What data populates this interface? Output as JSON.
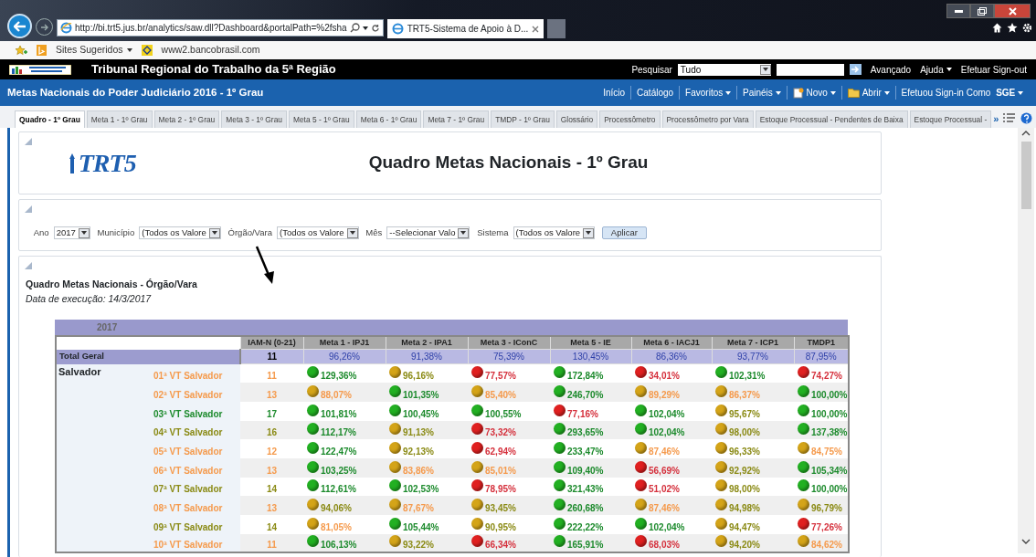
{
  "browser": {
    "address": "http://bi.trt5.jus.br/analytics/saw.dll?Dashboard&portalPath=%2fsha",
    "tab_title": "TRT5-Sistema de Apoio à D...",
    "favorites": [
      {
        "label": "Sites Sugeridos",
        "menu": true
      },
      {
        "label": "www2.bancobrasil.com",
        "menu": false
      }
    ]
  },
  "app_header": {
    "title": "Tribunal Regional do Trabalho da 5ª Região",
    "search_label": "Pesquisar",
    "search_scope": "Tudo",
    "links": [
      {
        "label": "Avançado",
        "menu": false
      },
      {
        "label": "Ajuda",
        "menu": true
      },
      {
        "label": "Efetuar Sign-out",
        "menu": false
      }
    ]
  },
  "nav": {
    "title": "Metas Nacionais do Poder Judiciário 2016 - 1º Grau",
    "links": [
      {
        "label": "Início",
        "menu": false
      },
      {
        "label": "Catálogo",
        "menu": false
      },
      {
        "label": "Favoritos",
        "menu": true
      },
      {
        "label": "Painéis",
        "menu": true
      },
      {
        "label": "Novo",
        "menu": true
      },
      {
        "label": "Abrir",
        "menu": true
      }
    ],
    "signed_in_label": "Efetuou Sign-in Como",
    "user": "SGE"
  },
  "tabs": [
    {
      "label": "Quadro - 1º Grau",
      "selected": true
    },
    {
      "label": "Meta 1 - 1º Grau",
      "selected": false
    },
    {
      "label": "Meta 2 - 1º Grau",
      "selected": false
    },
    {
      "label": "Meta 3 - 1º Grau",
      "selected": false
    },
    {
      "label": "Meta 5 - 1º Grau",
      "selected": false
    },
    {
      "label": "Meta 6 - 1º Grau",
      "selected": false
    },
    {
      "label": "Meta 7 - 1º Grau",
      "selected": false
    },
    {
      "label": "TMDP - 1º Grau",
      "selected": false
    },
    {
      "label": "Glossário",
      "selected": false
    },
    {
      "label": "Processômetro",
      "selected": false
    },
    {
      "label": "Processômetro por Vara",
      "selected": false
    },
    {
      "label": "Estoque Processual - Pendentes de Baixa",
      "selected": false
    },
    {
      "label": "Estoque Processual -",
      "selected": false
    }
  ],
  "tabs_overflow": "»",
  "title_panel": {
    "logo_text": "TRT5",
    "title": "Quadro Metas Nacionais - 1º Grau"
  },
  "filters": [
    {
      "label": "Ano",
      "value": "2017"
    },
    {
      "label": "Município",
      "value": "(Todos os Valore"
    },
    {
      "label": "Órgão/Vara",
      "value": "(Todos os Valore"
    },
    {
      "label": "Mês",
      "value": "--Selecionar Valo"
    },
    {
      "label": "Sistema",
      "value": "(Todos os Valore"
    }
  ],
  "apply_button": "Aplicar",
  "report": {
    "title": "Quadro Metas Nacionais - Órgão/Vara",
    "subtitle": "Data de execução: 14/3/2017"
  },
  "table": {
    "year": "2017",
    "columns": [
      "IAM-N (0-21)",
      "Meta 1 - IPJ1",
      "Meta 2 - IPA1",
      "Meta 3 - IConC",
      "Meta 5 - IE",
      "Meta 6 - IACJ1",
      "Meta 7 - ICP1",
      "TMDP1"
    ],
    "total": {
      "label": "Total Geral",
      "values": [
        "11",
        "96,26%",
        "91,38%",
        "75,39%",
        "130,45%",
        "86,36%",
        "93,77%",
        "87,95%"
      ]
    },
    "group": "Salvador",
    "rows": [
      {
        "name": "01ª VT Salvador",
        "kind": "low",
        "cells": [
          {
            "value": "11",
            "kind": "low"
          },
          {
            "value": "129,36%",
            "color": "#22b022",
            "kind": "good"
          },
          {
            "value": "96,16%",
            "color": "#d4a418",
            "kind": "warning"
          },
          {
            "value": "77,57%",
            "color": "#e02020",
            "kind": "bad"
          },
          {
            "value": "172,84%",
            "color": "#22b022",
            "kind": "good"
          },
          {
            "value": "34,01%",
            "color": "#e02020",
            "kind": "bad"
          },
          {
            "value": "102,31%",
            "color": "#22b022",
            "kind": "good"
          },
          {
            "value": "74,27%",
            "color": "#e02020",
            "kind": "bad"
          }
        ]
      },
      {
        "name": "02ª VT Salvador",
        "kind": "low",
        "cells": [
          {
            "value": "13",
            "kind": "low"
          },
          {
            "value": "88,07%",
            "color": "#d4a418",
            "kind": "low"
          },
          {
            "value": "101,35%",
            "color": "#22b022",
            "kind": "good"
          },
          {
            "value": "85,40%",
            "color": "#d4a418",
            "kind": "low"
          },
          {
            "value": "246,70%",
            "color": "#22b022",
            "kind": "good"
          },
          {
            "value": "89,29%",
            "color": "#d4a418",
            "kind": "low"
          },
          {
            "value": "86,37%",
            "color": "#d4a418",
            "kind": "low"
          },
          {
            "value": "100,00%",
            "color": "#22b022",
            "kind": "good"
          }
        ]
      },
      {
        "name": "03ª VT Salvador",
        "kind": "good",
        "cells": [
          {
            "value": "17",
            "kind": "good"
          },
          {
            "value": "101,81%",
            "color": "#22b022",
            "kind": "good"
          },
          {
            "value": "100,45%",
            "color": "#22b022",
            "kind": "good"
          },
          {
            "value": "100,55%",
            "color": "#22b022",
            "kind": "good"
          },
          {
            "value": "77,16%",
            "color": "#e02020",
            "kind": "bad"
          },
          {
            "value": "102,04%",
            "color": "#22b022",
            "kind": "good"
          },
          {
            "value": "95,67%",
            "color": "#d4a418",
            "kind": "warning"
          },
          {
            "value": "100,00%",
            "color": "#22b022",
            "kind": "good"
          }
        ]
      },
      {
        "name": "04ª VT Salvador",
        "kind": "warning",
        "cells": [
          {
            "value": "16",
            "kind": "warning"
          },
          {
            "value": "112,17%",
            "color": "#22b022",
            "kind": "good"
          },
          {
            "value": "91,13%",
            "color": "#d4a418",
            "kind": "warning"
          },
          {
            "value": "73,32%",
            "color": "#e02020",
            "kind": "bad"
          },
          {
            "value": "293,65%",
            "color": "#22b022",
            "kind": "good"
          },
          {
            "value": "102,04%",
            "color": "#22b022",
            "kind": "good"
          },
          {
            "value": "98,00%",
            "color": "#d4a418",
            "kind": "warning"
          },
          {
            "value": "137,38%",
            "color": "#22b022",
            "kind": "good"
          }
        ]
      },
      {
        "name": "05ª VT Salvador",
        "kind": "low",
        "cells": [
          {
            "value": "12",
            "kind": "low"
          },
          {
            "value": "122,47%",
            "color": "#22b022",
            "kind": "good"
          },
          {
            "value": "92,13%",
            "color": "#d4a418",
            "kind": "warning"
          },
          {
            "value": "62,94%",
            "color": "#e02020",
            "kind": "bad"
          },
          {
            "value": "233,47%",
            "color": "#22b022",
            "kind": "good"
          },
          {
            "value": "87,46%",
            "color": "#d4a418",
            "kind": "low"
          },
          {
            "value": "96,33%",
            "color": "#d4a418",
            "kind": "warning"
          },
          {
            "value": "84,75%",
            "color": "#d4a418",
            "kind": "low"
          }
        ]
      },
      {
        "name": "06ª VT Salvador",
        "kind": "low",
        "cells": [
          {
            "value": "13",
            "kind": "low"
          },
          {
            "value": "103,25%",
            "color": "#22b022",
            "kind": "good"
          },
          {
            "value": "83,86%",
            "color": "#d4a418",
            "kind": "low"
          },
          {
            "value": "85,01%",
            "color": "#d4a418",
            "kind": "low"
          },
          {
            "value": "109,40%",
            "color": "#22b022",
            "kind": "good"
          },
          {
            "value": "56,69%",
            "color": "#e02020",
            "kind": "bad"
          },
          {
            "value": "92,92%",
            "color": "#d4a418",
            "kind": "warning"
          },
          {
            "value": "105,34%",
            "color": "#22b022",
            "kind": "good"
          }
        ]
      },
      {
        "name": "07ª VT Salvador",
        "kind": "warning",
        "cells": [
          {
            "value": "14",
            "kind": "warning"
          },
          {
            "value": "112,61%",
            "color": "#22b022",
            "kind": "good"
          },
          {
            "value": "102,53%",
            "color": "#22b022",
            "kind": "good"
          },
          {
            "value": "78,95%",
            "color": "#e02020",
            "kind": "bad"
          },
          {
            "value": "321,43%",
            "color": "#22b022",
            "kind": "good"
          },
          {
            "value": "51,02%",
            "color": "#e02020",
            "kind": "bad"
          },
          {
            "value": "98,00%",
            "color": "#d4a418",
            "kind": "warning"
          },
          {
            "value": "100,00%",
            "color": "#22b022",
            "kind": "good"
          }
        ]
      },
      {
        "name": "08ª VT Salvador",
        "kind": "low",
        "cells": [
          {
            "value": "13",
            "kind": "low"
          },
          {
            "value": "94,06%",
            "color": "#d4a418",
            "kind": "warning"
          },
          {
            "value": "87,67%",
            "color": "#d4a418",
            "kind": "low"
          },
          {
            "value": "93,45%",
            "color": "#d4a418",
            "kind": "warning"
          },
          {
            "value": "260,68%",
            "color": "#22b022",
            "kind": "good"
          },
          {
            "value": "87,46%",
            "color": "#d4a418",
            "kind": "low"
          },
          {
            "value": "94,98%",
            "color": "#d4a418",
            "kind": "warning"
          },
          {
            "value": "96,79%",
            "color": "#d4a418",
            "kind": "warning"
          }
        ]
      },
      {
        "name": "09ª VT Salvador",
        "kind": "warning",
        "cells": [
          {
            "value": "14",
            "kind": "warning"
          },
          {
            "value": "81,05%",
            "color": "#d4a418",
            "kind": "low"
          },
          {
            "value": "105,44%",
            "color": "#22b022",
            "kind": "good"
          },
          {
            "value": "90,95%",
            "color": "#d4a418",
            "kind": "warning"
          },
          {
            "value": "222,22%",
            "color": "#22b022",
            "kind": "good"
          },
          {
            "value": "102,04%",
            "color": "#22b022",
            "kind": "good"
          },
          {
            "value": "94,47%",
            "color": "#d4a418",
            "kind": "warning"
          },
          {
            "value": "77,26%",
            "color": "#e02020",
            "kind": "bad"
          }
        ]
      },
      {
        "name": "10ª VT Salvador",
        "kind": "low",
        "cells": [
          {
            "value": "11",
            "kind": "low"
          },
          {
            "value": "106,13%",
            "color": "#22b022",
            "kind": "good"
          },
          {
            "value": "93,22%",
            "color": "#d4a418",
            "kind": "warning"
          },
          {
            "value": "66,34%",
            "color": "#e02020",
            "kind": "bad"
          },
          {
            "value": "165,91%",
            "color": "#22b022",
            "kind": "good"
          },
          {
            "value": "68,03%",
            "color": "#e02020",
            "kind": "bad"
          },
          {
            "value": "94,20%",
            "color": "#d4a418",
            "kind": "warning"
          },
          {
            "value": "84,62%",
            "color": "#d4a418",
            "kind": "low"
          }
        ]
      }
    ]
  }
}
